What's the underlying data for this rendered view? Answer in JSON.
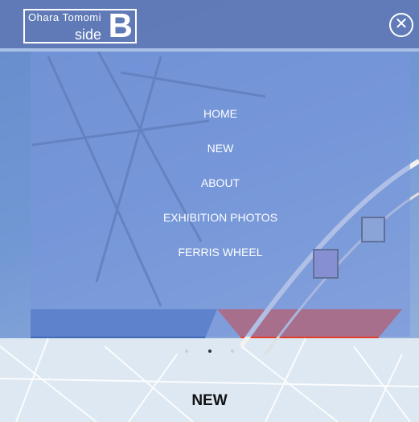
{
  "header": {
    "logo_name": "Ohara Tomomi",
    "logo_side": "side",
    "logo_letter": "B",
    "close_icon": "close-circle-icon"
  },
  "menu": {
    "items": [
      "HOME",
      "NEW",
      "ABOUT",
      "EXHIBITION PHOTOS",
      "FERRIS WHEEL"
    ]
  },
  "carousel": {
    "slides": 3,
    "active_index": 1
  },
  "section": {
    "title": "NEW"
  },
  "colors": {
    "header_bg": "#5f78b4",
    "overlay": "#7896dc",
    "accent_red": "#e0402a"
  }
}
